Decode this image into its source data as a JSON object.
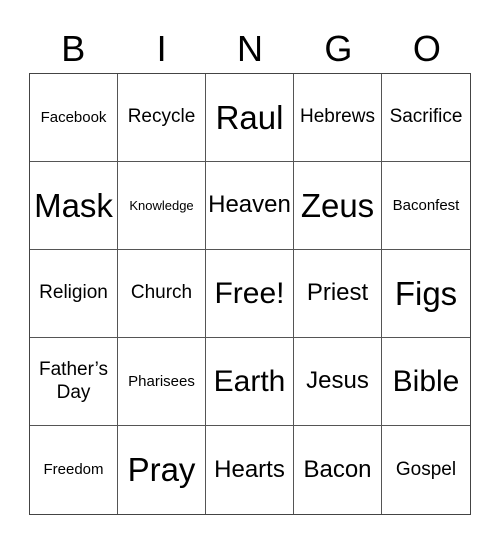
{
  "header": [
    "B",
    "I",
    "N",
    "G",
    "O"
  ],
  "cells": [
    {
      "text": "Facebook",
      "size": "sm"
    },
    {
      "text": "Recycle",
      "size": "md"
    },
    {
      "text": "Raul",
      "size": "xxl"
    },
    {
      "text": "Hebrews",
      "size": "md"
    },
    {
      "text": "Sacrifice",
      "size": "md"
    },
    {
      "text": "Mask",
      "size": "xxl"
    },
    {
      "text": "Knowledge",
      "size": "xs"
    },
    {
      "text": "Heaven",
      "size": "lg"
    },
    {
      "text": "Zeus",
      "size": "xxl"
    },
    {
      "text": "Baconfest",
      "size": "sm"
    },
    {
      "text": "Religion",
      "size": "md"
    },
    {
      "text": "Church",
      "size": "md"
    },
    {
      "text": "Free!",
      "size": "xl"
    },
    {
      "text": "Priest",
      "size": "lg"
    },
    {
      "text": "Figs",
      "size": "xxl"
    },
    {
      "text": "Father’s Day",
      "size": "md"
    },
    {
      "text": "Pharisees",
      "size": "sm"
    },
    {
      "text": "Earth",
      "size": "xl"
    },
    {
      "text": "Jesus",
      "size": "lg"
    },
    {
      "text": "Bible",
      "size": "xl"
    },
    {
      "text": "Freedom",
      "size": "sm"
    },
    {
      "text": "Pray",
      "size": "xxl"
    },
    {
      "text": "Hearts",
      "size": "lg"
    },
    {
      "text": "Bacon",
      "size": "lg"
    },
    {
      "text": "Gospel",
      "size": "md"
    }
  ]
}
